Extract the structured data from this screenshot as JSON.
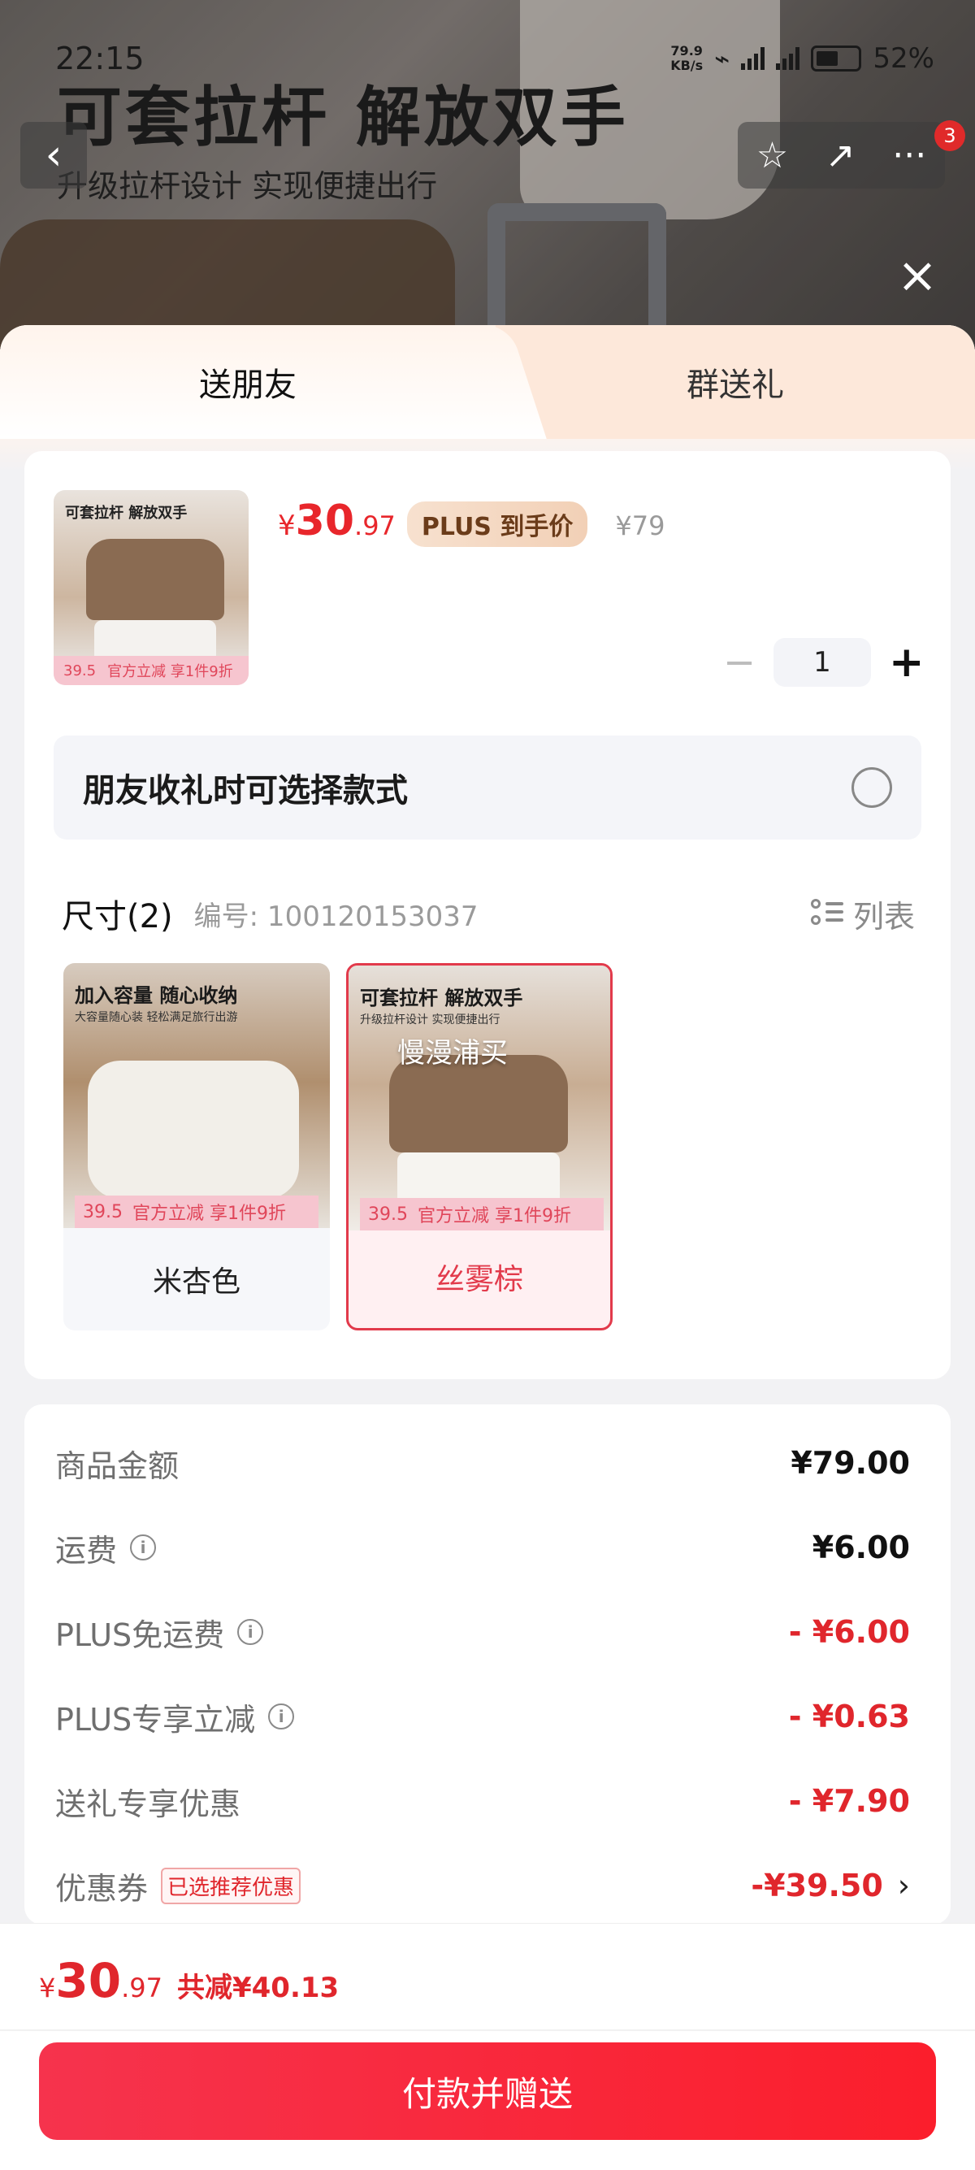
{
  "status_bar": {
    "time": "22:15",
    "net_speed_top": "79.9",
    "net_speed_bottom": "KB/s",
    "signal1": "5G",
    "signal2": "5G",
    "battery": "52%"
  },
  "hero": {
    "title": "可套拉杆 解放双手",
    "subtitle": "升级拉杆设计 实现便捷出行",
    "badge_count": "3"
  },
  "tabs": [
    {
      "label": "送朋友",
      "active": true
    },
    {
      "label": "群送礼",
      "active": false
    }
  ],
  "product": {
    "thumb_title": "可套拉杆 解放双手",
    "thumb_promo_price": "39.5",
    "thumb_promo_text": "官方立减 享1件9折",
    "price_symbol": "¥",
    "price_int": "30",
    "price_dec": ".97",
    "plus_tag": "PLUS 到手价",
    "original_price": "¥79",
    "quantity": "1"
  },
  "choose_option": {
    "label": "朋友收礼时可选择款式",
    "checked": false
  },
  "spec": {
    "label": "尺寸(2)",
    "sku": "编号: 100120153037",
    "list_label": "列表",
    "variants": [
      {
        "name": "米杏色",
        "caption": "加入容量 随心收纳",
        "caption_sub": "大容量随心装 轻松满足旅行出游",
        "promo_price": "39.5",
        "promo_text": "官方立减 享1件9折",
        "selected": false
      },
      {
        "name": "丝雾棕",
        "caption": "可套拉杆 解放双手",
        "caption_sub": "升级拉杆设计 实现便捷出行",
        "overlay": "慢漫浦买",
        "promo_price": "39.5",
        "promo_text": "官方立减 享1件9折",
        "selected": true
      }
    ]
  },
  "fees": [
    {
      "label": "商品金额",
      "value": "¥79.00",
      "info": false,
      "red": false
    },
    {
      "label": "运费",
      "value": "¥6.00",
      "info": true,
      "red": false
    },
    {
      "label": "PLUS免运费",
      "value": "- ¥6.00",
      "info": true,
      "red": true
    },
    {
      "label": "PLUS专享立减",
      "value": "- ¥0.63",
      "info": true,
      "red": true
    },
    {
      "label": "送礼专享优惠",
      "value": "- ¥7.90",
      "info": false,
      "red": true
    },
    {
      "label": "优惠券",
      "value": "-¥39.50",
      "info": false,
      "red": true,
      "tag": "已选推荐优惠"
    }
  ],
  "footer": {
    "total_symbol": "¥",
    "total_int": "30",
    "total_dec": ".97",
    "total_saved": "共减¥40.13",
    "pay_button": "付款并赠送"
  },
  "colors": {
    "accent_red": "#e0262c",
    "plus_gold": "#6b3c1a",
    "selected_border": "#e23a4b"
  }
}
